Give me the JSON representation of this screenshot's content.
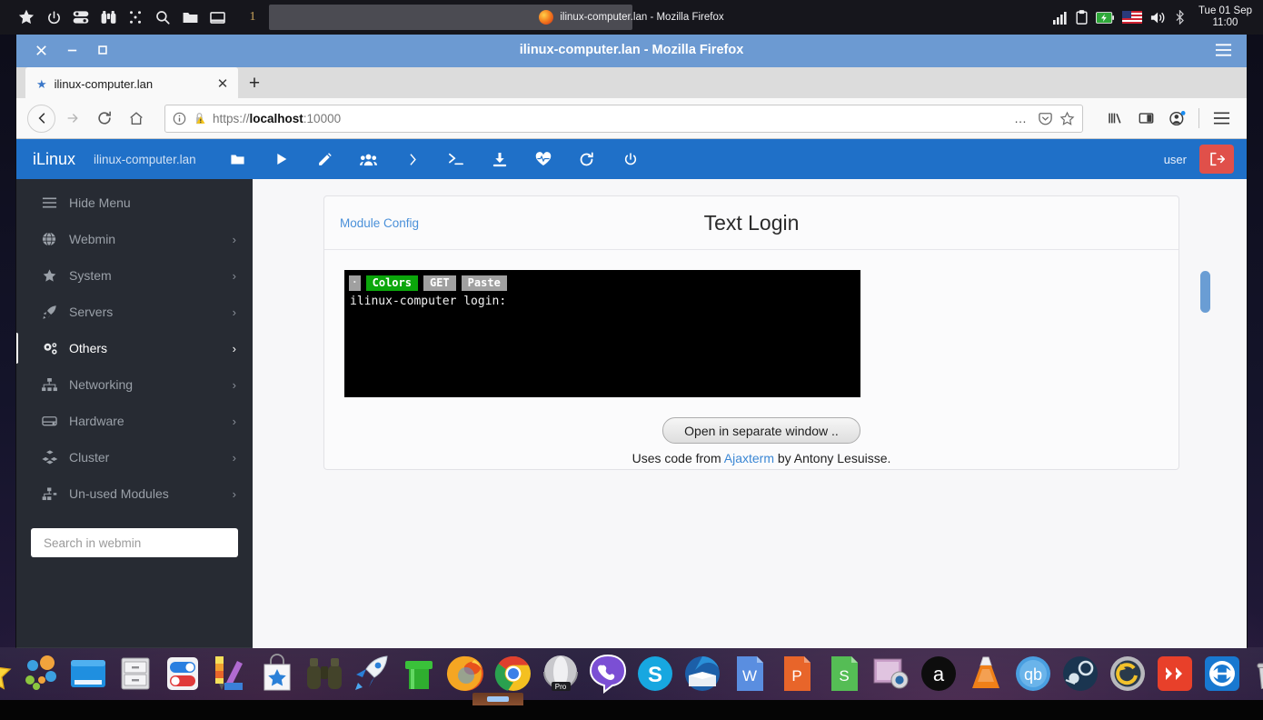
{
  "top_panel": {
    "launchers": [
      {
        "name": "star-icon",
        "label": "Favorites"
      },
      {
        "name": "power-icon",
        "label": "Power"
      },
      {
        "name": "settings-toggle-icon",
        "label": "Settings"
      },
      {
        "name": "binoculars-icon",
        "label": "Find"
      },
      {
        "name": "grid-dots-icon",
        "label": "Applications"
      },
      {
        "name": "search-icon",
        "label": "Search"
      },
      {
        "name": "folder-icon",
        "label": "Files"
      },
      {
        "name": "window-icon",
        "label": "Show Desktop"
      }
    ],
    "workspace_number": "1",
    "window_title": "ilinux-computer.lan - Mozilla Firefox",
    "tray": [
      {
        "name": "signal-bars-icon"
      },
      {
        "name": "clipboard-icon"
      },
      {
        "name": "battery-charging-icon"
      },
      {
        "name": "flag-us-icon"
      },
      {
        "name": "volume-icon"
      },
      {
        "name": "bluetooth-icon"
      }
    ],
    "clock_date": "Tue 01 Sep",
    "clock_time": "11:00"
  },
  "firefox": {
    "window_title": "ilinux-computer.lan - Mozilla Firefox",
    "window_buttons": [
      {
        "name": "close-window-button",
        "glyph": "✕"
      },
      {
        "name": "minimize-window-button",
        "glyph": "─"
      },
      {
        "name": "maximize-window-button",
        "glyph": "□"
      }
    ],
    "menu_button": "hamburger-menu-icon",
    "tab": {
      "title": "ilinux-computer.lan",
      "close_glyph": "✕",
      "favicon": "star-icon"
    },
    "new_tab_glyph": "+",
    "nav": {
      "back": "back-arrow-icon",
      "forward": "forward-arrow-icon",
      "reload": "reload-icon",
      "home": "home-icon"
    },
    "url": {
      "scheme": "https://",
      "host": "localhost",
      "port": ":10000",
      "full": "https://localhost:10000",
      "info_icon": "page-info-icon",
      "security_icon": "insecure-lock-warning-icon",
      "page_actions": "…",
      "pocket_icon": "pocket-icon",
      "bookmark_icon": "bookmark-star-icon"
    },
    "toolbar_right": [
      {
        "name": "library-icon"
      },
      {
        "name": "sidebar-icon"
      },
      {
        "name": "account-icon"
      },
      {
        "name": "app-menu-icon"
      }
    ]
  },
  "webmin": {
    "brand": "iLinux",
    "hostname": "ilinux-computer.lan",
    "navbar_icons": [
      {
        "name": "file-manager-icon"
      },
      {
        "name": "run-icon"
      },
      {
        "name": "edit-file-icon"
      },
      {
        "name": "users-icon"
      },
      {
        "name": "chevron-right-icon"
      },
      {
        "name": "terminal-icon"
      },
      {
        "name": "download-icon"
      },
      {
        "name": "system-health-icon"
      },
      {
        "name": "refresh-icon"
      },
      {
        "name": "power-icon"
      }
    ],
    "user_label": "user",
    "logout_icon": "logout-icon",
    "accent_color": "#1f70c8",
    "logout_color": "#e0504a",
    "sidebar": {
      "hide_menu_label": "Hide Menu",
      "hide_menu_icon": "hamburger-icon",
      "items": [
        {
          "label": "Webmin",
          "icon": "globe-icon",
          "chevron": "›",
          "active": false
        },
        {
          "label": "System",
          "icon": "star-icon",
          "chevron": "›",
          "active": false
        },
        {
          "label": "Servers",
          "icon": "rocket-icon",
          "chevron": "›",
          "active": false
        },
        {
          "label": "Others",
          "icon": "gears-icon",
          "chevron": "›",
          "active": true
        },
        {
          "label": "Networking",
          "icon": "sitemap-icon",
          "chevron": "›",
          "active": false
        },
        {
          "label": "Hardware",
          "icon": "hdd-icon",
          "chevron": "›",
          "active": false
        },
        {
          "label": "Cluster",
          "icon": "cubes-icon",
          "chevron": "›",
          "active": false
        },
        {
          "label": "Un-used Modules",
          "icon": "plug-icon",
          "chevron": "›",
          "active": false
        }
      ],
      "search_placeholder": "Search in webmin",
      "search_value": ""
    },
    "panel": {
      "module_config_link": "Module Config",
      "title": "Text Login",
      "terminal": {
        "buttons": [
          {
            "label": "·",
            "name": "terminal-menu-button",
            "style": "dot"
          },
          {
            "label": "Colors",
            "name": "terminal-colors-button",
            "style": "green"
          },
          {
            "label": "GET",
            "name": "terminal-get-button",
            "style": "gray"
          },
          {
            "label": "Paste",
            "name": "terminal-paste-button",
            "style": "gray"
          }
        ],
        "output": "ilinux-computer login:"
      },
      "open_window_button": "Open in separate window ..",
      "credit_prefix": "Uses code from ",
      "credit_link": "Ajaxterm",
      "credit_suffix": " by Antony Lesuisse."
    }
  },
  "dock": {
    "items": [
      {
        "name": "dock-star-icon",
        "label": "Favorites"
      },
      {
        "name": "dock-bubbles-icon",
        "label": "Apps"
      },
      {
        "name": "dock-window-icon",
        "label": "Window Manager"
      },
      {
        "name": "dock-filecabinet-icon",
        "label": "File Manager"
      },
      {
        "name": "dock-toggles-icon",
        "label": "Settings"
      },
      {
        "name": "dock-palette-icon",
        "label": "Appearance"
      },
      {
        "name": "dock-store-icon",
        "label": "Software Store"
      },
      {
        "name": "dock-binoculars-icon",
        "label": "Search"
      },
      {
        "name": "dock-rocket-icon",
        "label": "Launcher"
      },
      {
        "name": "dock-pipe-icon",
        "label": "Terminal"
      },
      {
        "name": "dock-firefox-icon",
        "label": "Firefox"
      },
      {
        "name": "dock-chrome-icon",
        "label": "Chrome"
      },
      {
        "name": "dock-opera-icon",
        "label": "Opera Pro"
      },
      {
        "name": "dock-viber-icon",
        "label": "Viber"
      },
      {
        "name": "dock-skype-icon",
        "label": "Skype"
      },
      {
        "name": "dock-thunderbird-icon",
        "label": "Thunderbird"
      },
      {
        "name": "dock-word-icon",
        "label": "Writer"
      },
      {
        "name": "dock-impress-icon",
        "label": "Impress"
      },
      {
        "name": "dock-calc-icon",
        "label": "Calc"
      },
      {
        "name": "dock-screenshot-icon",
        "label": "Screenshot"
      },
      {
        "name": "dock-amazon-icon",
        "label": "Amazon"
      },
      {
        "name": "dock-vlc-icon",
        "label": "VLC"
      },
      {
        "name": "dock-qbittorrent-icon",
        "label": "qBittorrent"
      },
      {
        "name": "dock-steam-icon",
        "label": "Steam"
      },
      {
        "name": "dock-timeshift-icon",
        "label": "Timeshift"
      },
      {
        "name": "dock-anydesk-icon",
        "label": "AnyDesk"
      },
      {
        "name": "dock-teamviewer-icon",
        "label": "TeamViewer"
      },
      {
        "name": "dock-trash-icon",
        "label": "Trash"
      }
    ]
  }
}
